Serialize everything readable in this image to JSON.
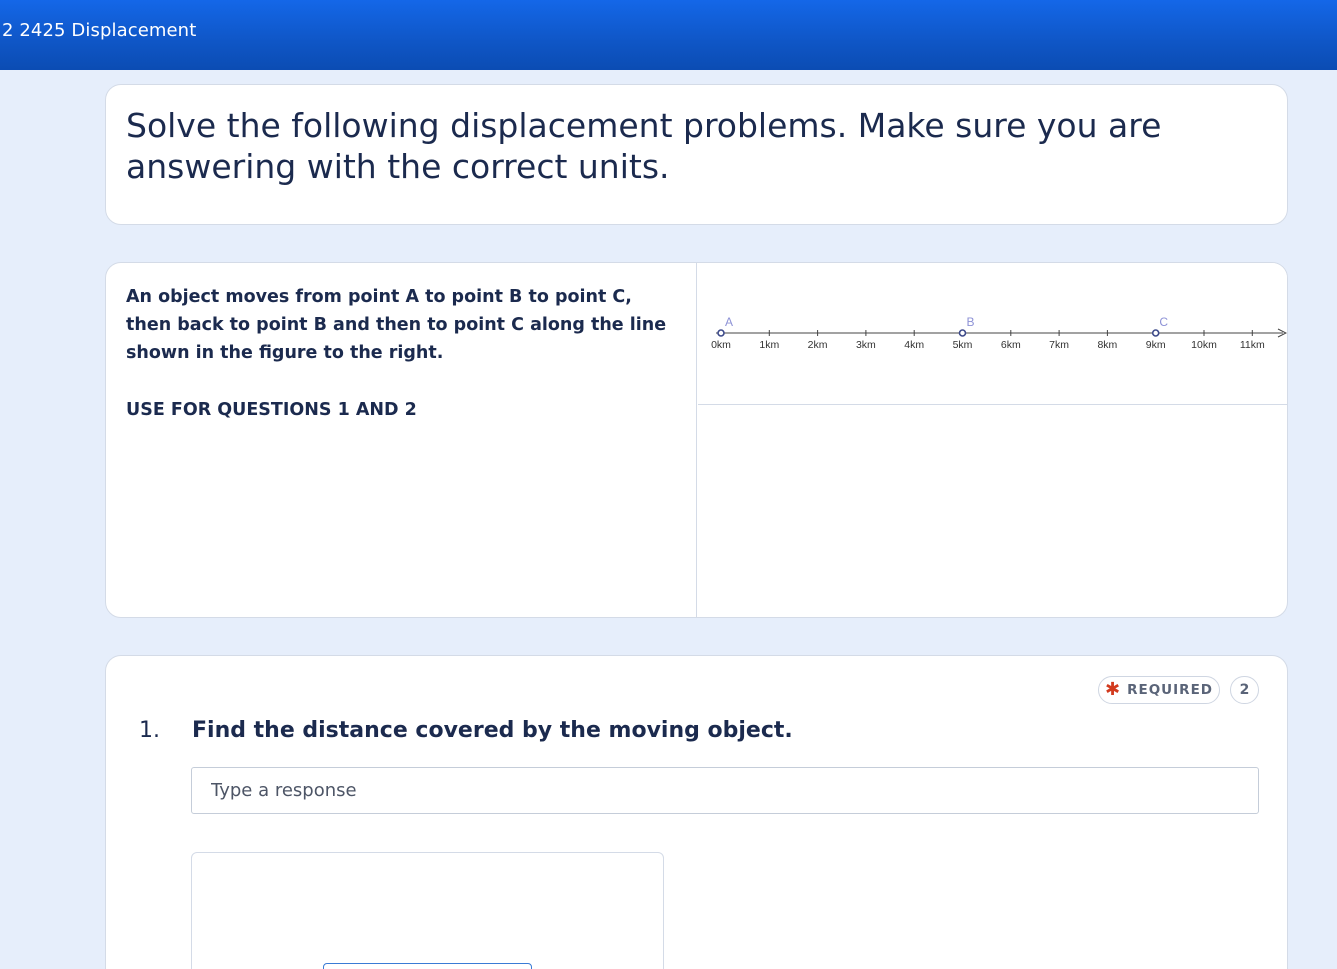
{
  "topbar": {
    "title": "2 2425 Displacement"
  },
  "header": {
    "heading": "Solve the following displacement problems.  Make sure you are answering with the correct units."
  },
  "section": {
    "description": "An object moves from point A to point B to point C, then back to point B and then to point C along the line shown in the figure to the right.",
    "note": "USE FOR QUESTIONS 1 AND 2",
    "figure": {
      "tick_labels": [
        "0km",
        "1km",
        "2km",
        "3km",
        "4km",
        "5km",
        "6km",
        "7km",
        "8km",
        "9km",
        "10km",
        "11km"
      ],
      "points": [
        {
          "label": "A",
          "value": 0
        },
        {
          "label": "B",
          "value": 5
        },
        {
          "label": "C",
          "value": 9
        }
      ],
      "colors": {
        "line": "#444444",
        "point": "#3d4a8a",
        "point_label": "#8d92d6",
        "tick_label": "#333333"
      }
    }
  },
  "question": {
    "number": "1.",
    "text": "Find the distance covered by the moving object.",
    "required_label": "REQUIRED",
    "points": "2",
    "input_placeholder": "Type a response",
    "input_value": ""
  }
}
